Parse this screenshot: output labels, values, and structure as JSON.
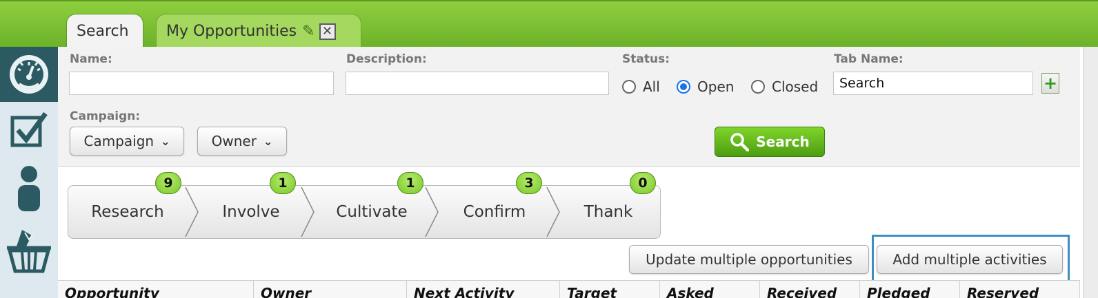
{
  "tabs": {
    "active_label": "Search",
    "second_label": "My Opportunities"
  },
  "form": {
    "name_label": "Name:",
    "name_value": "",
    "description_label": "Description:",
    "description_value": "",
    "status_label": "Status:",
    "status_options": [
      "All",
      "Open",
      "Closed"
    ],
    "status_selected": "Open",
    "tabname_label": "Tab Name:",
    "tabname_value": "Search",
    "campaign_label": "Campaign:",
    "campaign_dropdown": "Campaign",
    "owner_dropdown": "Owner",
    "search_button": "Search"
  },
  "pipeline": {
    "stages": [
      {
        "label": "Research",
        "count": "9"
      },
      {
        "label": "Involve",
        "count": "1"
      },
      {
        "label": "Cultivate",
        "count": "1"
      },
      {
        "label": "Confirm",
        "count": "3"
      },
      {
        "label": "Thank",
        "count": "0"
      }
    ]
  },
  "actions": {
    "update_multiple": "Update multiple opportunities",
    "add_activities": "Add multiple activities"
  },
  "table": {
    "columns": [
      "Opportunity",
      "Owner",
      "Next Activity",
      "Target",
      "Asked",
      "Received",
      "Pledged",
      "Reserved"
    ]
  },
  "colors": {
    "accent_green": "#6cb22a",
    "nav_dark": "#2c5a63",
    "highlight_blue": "#3c8fc4"
  },
  "icons": [
    "dashboard-gauge-icon",
    "checkbox-task-icon",
    "person-icon",
    "basket-gift-icon",
    "pencil-icon",
    "close-icon",
    "add-tab-icon",
    "magnifier-icon",
    "chevron-down-icon"
  ]
}
